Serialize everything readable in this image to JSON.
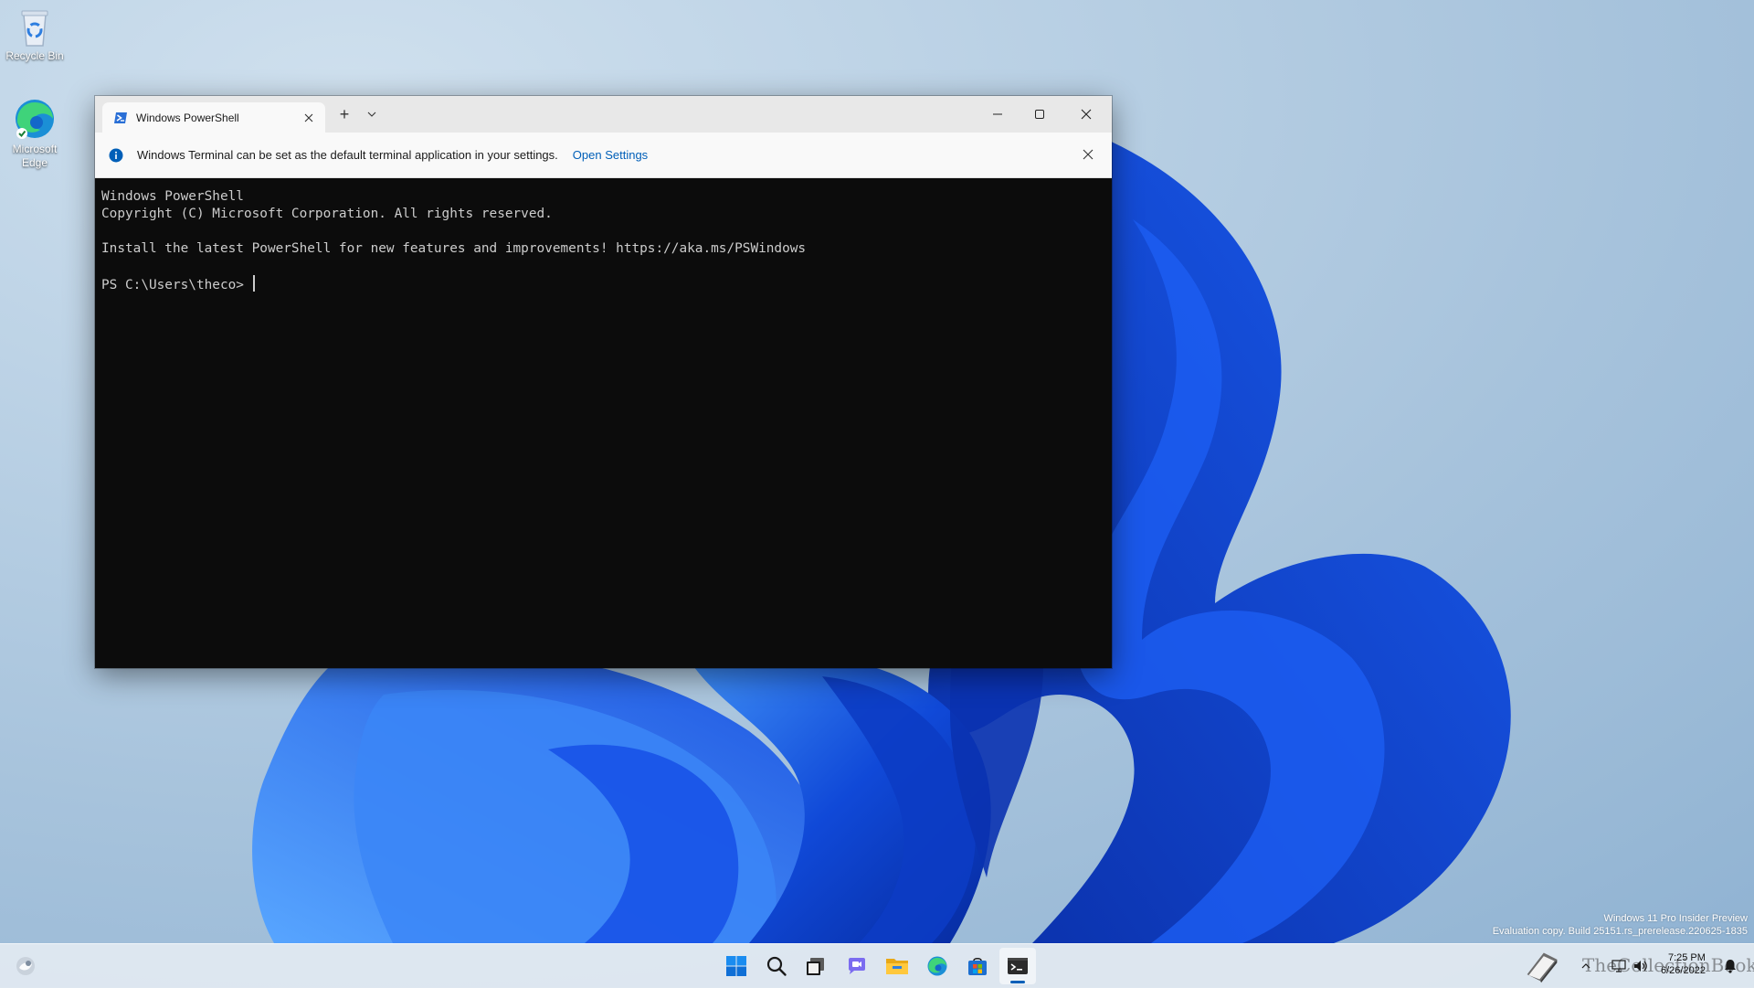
{
  "desktop": {
    "icons": [
      {
        "label": "Recycle Bin"
      },
      {
        "label": "Microsoft Edge"
      }
    ],
    "watermark": {
      "line1": "Windows 11 Pro Insider Preview",
      "line2": "Evaluation copy. Build 25151.rs_prerelease.220625-1835"
    }
  },
  "window": {
    "tab": {
      "title": "Windows PowerShell",
      "icon": "powershell-icon"
    },
    "controls": {
      "new_tab": "+",
      "minimize": "minimize-icon",
      "maximize": "maximize-icon",
      "close": "close-icon"
    },
    "infobar": {
      "message": "Windows Terminal can be set as the default terminal application in your settings.",
      "link": "Open Settings"
    },
    "terminal": {
      "lines": [
        "Windows PowerShell",
        "Copyright (C) Microsoft Corporation. All rights reserved.",
        "",
        "Install the latest PowerShell for new features and improvements! https://aka.ms/PSWindows",
        ""
      ],
      "prompt": "PS C:\\Users\\theco> "
    }
  },
  "taskbar": {
    "items": [
      "widgets-icon",
      "start-icon",
      "search-icon",
      "task-view-icon",
      "chat-icon",
      "file-explorer-icon",
      "edge-icon",
      "store-icon",
      "terminal-icon"
    ],
    "tray": {
      "time": "7:25 PM",
      "date": "6/26/2022",
      "brand": "TheCollectionBook"
    }
  },
  "colors": {
    "accent": "#005fb8",
    "terminal_bg": "#0c0c0c",
    "terminal_fg": "#cccccc"
  }
}
